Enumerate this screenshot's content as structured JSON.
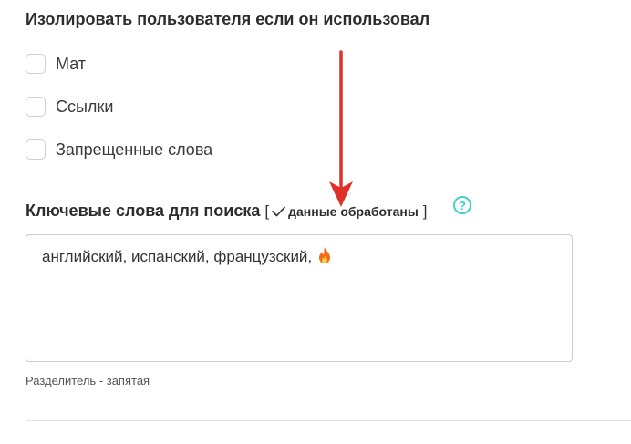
{
  "isolate_section": {
    "title": "Изолировать пользователя если он использовал",
    "options": [
      {
        "label": "Мат",
        "checked": false
      },
      {
        "label": "Ссылки",
        "checked": false
      },
      {
        "label": "Запрещенные слова",
        "checked": false
      }
    ]
  },
  "keywords_section": {
    "title": "Ключевые слова для поиска",
    "bracket_open": "[",
    "status_text": "данные обработаны",
    "bracket_close": "]",
    "help_label": "?",
    "value": "английский, испанский, французский,",
    "hint": "Разделитель - запятая"
  },
  "colors": {
    "accent_teal": "#3fd2c7",
    "annotation_arrow": "#e0302a",
    "fire_emoji": "#f26a1b"
  },
  "icons": {
    "status": "checkmark-icon",
    "help": "help-circle-icon",
    "emoji": "fire-emoji-icon"
  }
}
